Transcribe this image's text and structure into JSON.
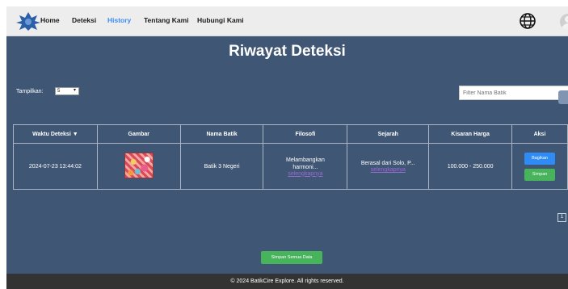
{
  "nav": {
    "links": [
      {
        "label": "Home"
      },
      {
        "label": "Deteksi"
      },
      {
        "label": "History"
      },
      {
        "label": "Tentang Kami"
      },
      {
        "label": "Hubungi Kami"
      }
    ],
    "active": "History",
    "active_color": "#3d8bf2"
  },
  "page": {
    "title": "Riwayat Deteksi"
  },
  "controls": {
    "show_label": "Tampilkan:",
    "show_value": "5",
    "filter_placeholder": "Filter Nama Batik"
  },
  "table": {
    "headers": [
      "Waktu Deteksi ▼",
      "Gambar",
      "Nama Batik",
      "Filosofi",
      "Sejarah",
      "Kisaran Harga",
      "Aksi"
    ],
    "rows": [
      {
        "time": "2024-07-23 13:44:02",
        "name": "Batik 3 Negeri",
        "philosophy_text": "Melambangkan harmoni...",
        "philosophy_link": "selengkapnya",
        "history_text": "Berasal dari Solo, P...",
        "history_link": "selengkapnya",
        "price": "100.000 - 250.000",
        "share_label": "Bagikan",
        "save_label": "Simpan"
      }
    ]
  },
  "pagination": {
    "current": "1"
  },
  "save_all_label": "Simpan Semua Data",
  "footer": {
    "text": "© 2024 BatikCire Explore. All rights reserved."
  },
  "colors": {
    "background": "#3f5674",
    "navbar": "#ededed",
    "footer": "#333333",
    "share_button": "#2f8cf6",
    "save_button": "#47b35a"
  }
}
